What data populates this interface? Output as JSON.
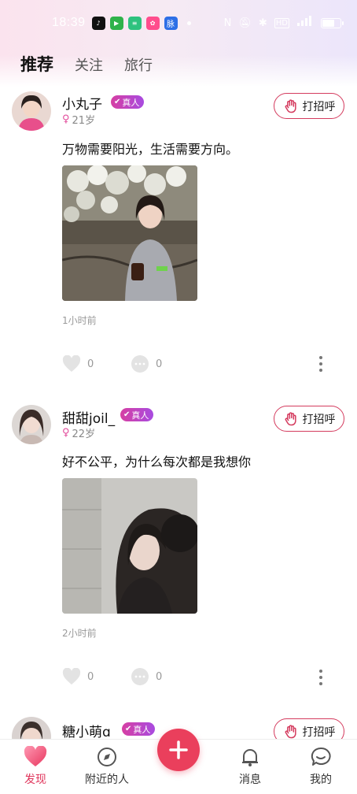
{
  "status_bar": {
    "time": "18:39",
    "app_icons": [
      {
        "name": "tiktok-icon",
        "color": "#111111"
      },
      {
        "name": "video-icon",
        "color": "#2fb24a"
      },
      {
        "name": "menu-app-icon",
        "color": "#2ec27e"
      },
      {
        "name": "shop-app-icon",
        "color": "#ff4d8d"
      },
      {
        "name": "mai-app-icon",
        "color": "#2d6fe6",
        "text": "脉"
      }
    ]
  },
  "tabs": [
    {
      "label": "推荐",
      "active": true
    },
    {
      "label": "关注",
      "active": false
    },
    {
      "label": "旅行",
      "active": false
    }
  ],
  "posts": [
    {
      "nickname": "小丸子",
      "badge": "真人",
      "age": "21岁",
      "greet_label": "打招呼",
      "content": "万物需要阳光，生活需要方向。",
      "time_ago": "1小时前",
      "likes": "0",
      "comments": "0"
    },
    {
      "nickname": "甜甜joil_",
      "badge": "真人",
      "age": "22岁",
      "greet_label": "打招呼",
      "content": "好不公平，为什么每次都是我想你",
      "time_ago": "2小时前",
      "likes": "0",
      "comments": "0"
    },
    {
      "nickname": "糖小萌ɑ",
      "badge": "真人",
      "greet_label": "打招呼"
    }
  ],
  "bottom_nav": [
    {
      "label": "发现",
      "icon": "heart-icon",
      "active": true
    },
    {
      "label": "附近的人",
      "icon": "compass-icon",
      "active": false
    },
    {
      "label": "",
      "icon": "plus-icon",
      "active": false
    },
    {
      "label": "消息",
      "icon": "bell-icon",
      "active": false
    },
    {
      "label": "我的",
      "icon": "chat-bubble-icon",
      "active": false
    }
  ],
  "colors": {
    "accent": "#e0365c",
    "badge_gradient": [
      "#d63fa3",
      "#a84be0"
    ],
    "fab": "#ea3f5c"
  }
}
